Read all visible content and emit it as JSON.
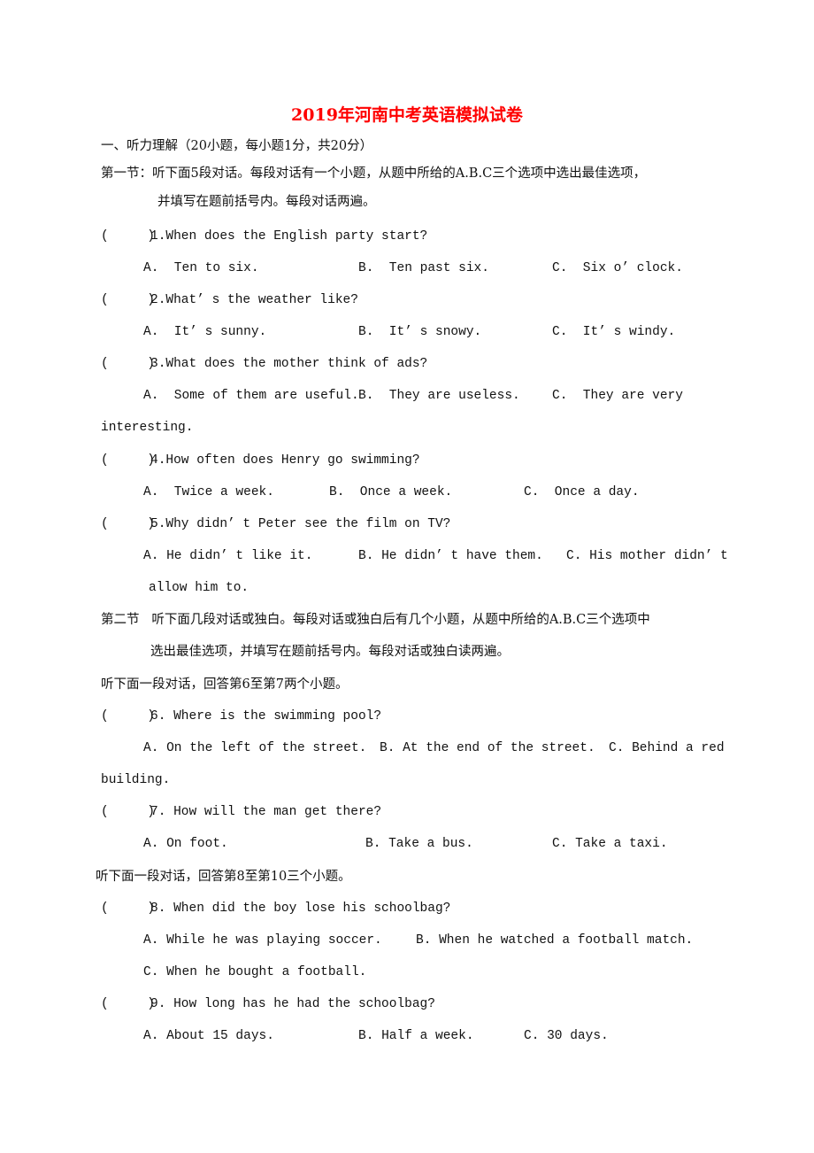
{
  "title": "2019年河南中考英语模拟试卷",
  "accent_color": "#ff0000",
  "section1_heading": "一、听力理解（20小题，每小题1分，共20分）",
  "part1": {
    "line1": "第一节：听下面5段对话。每段对话有一个小题，从题中所给的A.B.C三个选项中选出最佳选项，",
    "line2": "并填写在题前括号内。每段对话两遍。"
  },
  "questions": [
    {
      "paren": "(     )",
      "q": "1.When does the English party start?",
      "a": "A.  Ten to six.",
      "b": "B.  Ten past six.",
      "c": "C.  Six o’ clock."
    },
    {
      "paren": "(     )",
      "q": "2.What’ s the weather like?",
      "a": "A.  It’ s sunny.",
      "b": "B.  It’ s snowy.",
      "c": "C.  It’ s windy."
    },
    {
      "paren": "(     )",
      "q": "3.What does the mother think of ads?",
      "a": "A.  Some of them are useful.",
      "b": "B.  They are useless.",
      "c": "C.  They are very",
      "cont": "interesting."
    },
    {
      "paren": "(     )",
      "q": "4.How often does Henry go swimming?",
      "a": "A.  Twice a week.",
      "b": "B.  Once a week.",
      "c": "C.  Once a day."
    },
    {
      "paren": "(     )",
      "q": "5.Why didn’ t Peter see the film on TV?",
      "a": "A. He didn’ t like it.",
      "b": "B. He didn’ t have them.",
      "c": "C. His mother didn’ t",
      "cont": "allow him to."
    },
    {
      "paren": "(     )",
      "q": "6. Where is the swimming pool?",
      "a": "A. On the left of the street.",
      "b": "B. At the end of the street.",
      "c": "C. Behind a red",
      "cont": "building."
    },
    {
      "paren": "(     )",
      "q": "7. How will the man get there?",
      "a": "A. On foot.",
      "b": "B. Take a bus.",
      "c": "C. Take a taxi."
    },
    {
      "paren": "(     )",
      "q": "8. When did the boy lose his schoolbag?",
      "a": "A. While he was playing soccer.",
      "b": "B. When he watched a football match.",
      "c": "C. When he bought a football."
    },
    {
      "paren": "(     )",
      "q": "9. How long has he had the schoolbag?",
      "a": "A. About 15 days.",
      "b": "B. Half a week.",
      "c": "C. 30 days."
    }
  ],
  "part2": {
    "line1": "第二节   听下面几段对话或独白。每段对话或独白后有几个小题，从题中所给的A.B.C三个选项中",
    "line2": "选出最佳选项，并填写在题前括号内。每段对话或独白读两遍。"
  },
  "instr_6_7": "听下面一段对话，回答第6至第7两个小题。",
  "instr_8_10": "听下面一段对话，回答第8至第10三个小题。"
}
